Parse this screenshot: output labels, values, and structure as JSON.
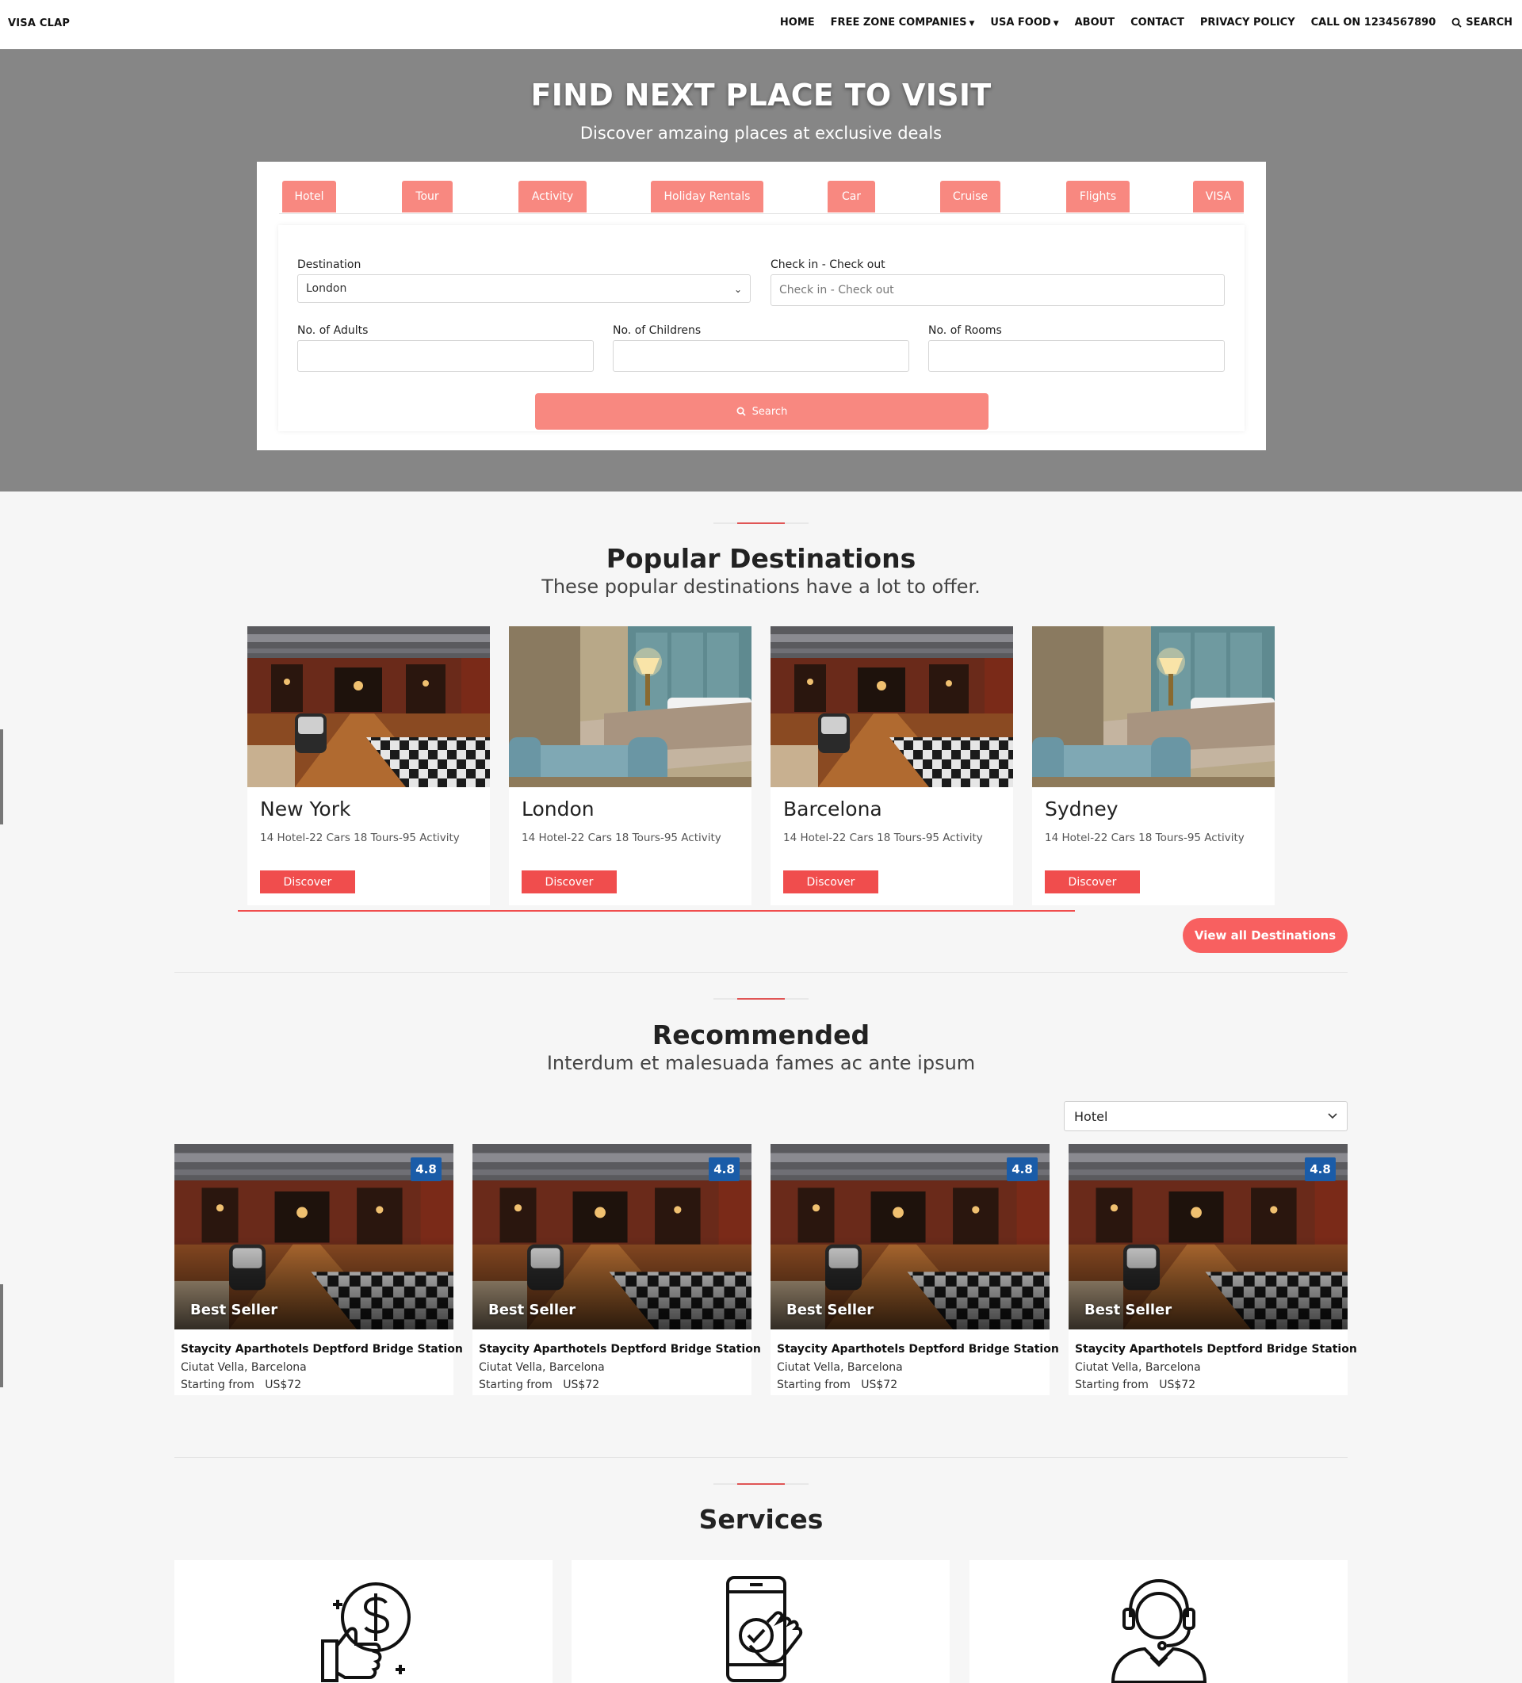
{
  "nav": {
    "brand": "VISA CLAP",
    "items": [
      {
        "label": "HOME"
      },
      {
        "label": "FREE ZONE COMPANIES",
        "dropdown": true
      },
      {
        "label": "USA FOOD",
        "dropdown": true
      },
      {
        "label": "ABOUT"
      },
      {
        "label": "CONTACT"
      },
      {
        "label": "PRIVACY POLICY"
      },
      {
        "label": "CALL ON 1234567890"
      }
    ],
    "search_label": "SEARCH"
  },
  "hero": {
    "title": "FIND NEXT PLACE TO VISIT",
    "subtitle": "Discover amzaing places at exclusive deals"
  },
  "tabs": [
    "Hotel",
    "Tour",
    "Activity",
    "Holiday Rentals",
    "Car",
    "Cruise",
    "Flights",
    "VISA"
  ],
  "form": {
    "destination_label": "Destination",
    "destination_value": "London",
    "checkin_label": "Check in - Check out",
    "checkin_placeholder": "Check in - Check out",
    "adults_label": "No. of Adults",
    "children_label": "No. of Childrens",
    "rooms_label": "No. of Rooms",
    "search_label": "Search"
  },
  "popular": {
    "title": "Popular Destinations",
    "subtitle": "These popular destinations have a lot to offer.",
    "cards": [
      {
        "name": "New York",
        "meta": "14 Hotel-22 Cars 18 Tours-95 Activity",
        "button": "Discover",
        "image": "lobby"
      },
      {
        "name": "London",
        "meta": "14 Hotel-22 Cars 18 Tours-95 Activity",
        "button": "Discover",
        "image": "bedroom"
      },
      {
        "name": "Barcelona",
        "meta": "14 Hotel-22 Cars 18 Tours-95 Activity",
        "button": "Discover",
        "image": "lobby"
      },
      {
        "name": "Sydney",
        "meta": "14 Hotel-22 Cars 18 Tours-95 Activity",
        "button": "Discover",
        "image": "bedroom"
      }
    ],
    "view_all": "View all Destinations"
  },
  "recommended": {
    "title": "Recommended",
    "subtitle": "Interdum et malesuada fames ac ante ipsum",
    "filter_value": "Hotel",
    "cards": [
      {
        "rating": "4.8",
        "badge": "Best Seller",
        "title": "Staycity Aparthotels Deptford Bridge Station",
        "location": "Ciutat Vella, Barcelona",
        "price_label": "Starting from",
        "price": "US$72"
      },
      {
        "rating": "4.8",
        "badge": "Best Seller",
        "title": "Staycity Aparthotels Deptford Bridge Station",
        "location": "Ciutat Vella, Barcelona",
        "price_label": "Starting from",
        "price": "US$72"
      },
      {
        "rating": "4.8",
        "badge": "Best Seller",
        "title": "Staycity Aparthotels Deptford Bridge Station",
        "location": "Ciutat Vella, Barcelona",
        "price_label": "Starting from",
        "price": "US$72"
      },
      {
        "rating": "4.8",
        "badge": "Best Seller",
        "title": "Staycity Aparthotels Deptford Bridge Station",
        "location": "Ciutat Vella, Barcelona",
        "price_label": "Starting from",
        "price": "US$72"
      }
    ]
  },
  "services": {
    "title": "Services",
    "icons": [
      "price-thumbs-up-icon",
      "mobile-booking-icon",
      "customer-support-icon"
    ]
  },
  "colors": {
    "accent": "#f88880",
    "button_red": "#f04d4d",
    "hero_bg": "#868686",
    "rating_blue": "#1a5ca8"
  }
}
